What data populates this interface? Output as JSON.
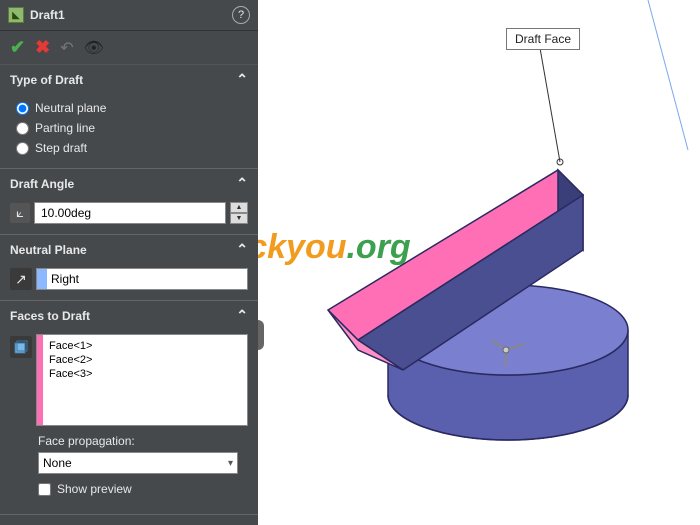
{
  "feature": {
    "title": "Draft1"
  },
  "typeOfDraft": {
    "header": "Type of Draft",
    "options": {
      "neutral": "Neutral plane",
      "parting": "Parting line",
      "step": "Step draft"
    },
    "selected": "neutral"
  },
  "draftAngle": {
    "header": "Draft Angle",
    "value": "10.00deg"
  },
  "neutralPlane": {
    "header": "Neutral Plane",
    "value": "Right"
  },
  "facesToDraft": {
    "header": "Faces to Draft",
    "items": [
      "Face<1>",
      "Face<2>",
      "Face<3>"
    ],
    "propagationLabel": "Face propagation:",
    "propagationValue": "None",
    "showPreviewLabel": "Show preview",
    "showPreviewChecked": false
  },
  "callout": {
    "label": "Draft Face"
  },
  "watermark": {
    "p1": "luckyou",
    "p2": ".org"
  },
  "colors": {
    "highlight": "#ff6fb5",
    "body": "#5a5fae",
    "bodyLight": "#7a7fd0",
    "edge": "#2a2a60"
  }
}
